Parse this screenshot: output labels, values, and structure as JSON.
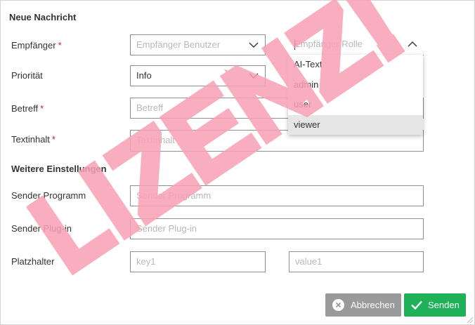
{
  "form": {
    "title": "Neue Nachricht",
    "section_title": "Weitere Einstellungen"
  },
  "labels": {
    "recipient": "Empfänger",
    "priority": "Priorität",
    "subject": "Betreff",
    "body": "Textinhalt",
    "sender_program": "Sender Programm",
    "sender_plugin": "Sender Plug-in",
    "placeholder": "Platzhalter",
    "required_mark": "*"
  },
  "fields": {
    "recipient_user_placeholder": "Empfänger Benutzer",
    "recipient_role_placeholder": "Empfänger Rolle",
    "priority_value": "Info",
    "subject_placeholder": "Betreff",
    "body_placeholder": "Textinhalt",
    "sender_program_placeholder": "Sender Programm",
    "sender_plugin_placeholder": "Sender Plug-in",
    "key_placeholder": "key1",
    "value_placeholder": "value1"
  },
  "role_dropdown": {
    "options": [
      "AI-Text",
      "admin",
      "user",
      "viewer"
    ],
    "highlighted": "viewer"
  },
  "buttons": {
    "cancel": "Abbrechen",
    "send": "Senden"
  },
  "watermark": {
    "text": "LIZENZ!",
    "color": "#f7a1b5"
  },
  "colors": {
    "send_button": "#1eb157",
    "cancel_button": "#9a9a9a",
    "focus_underline": "#2e9e96",
    "required": "#d02020"
  },
  "icons": {
    "select_chevron": "chevron-down-icon",
    "open_chevron": "chevron-up-icon",
    "cancel": "close-circle-icon",
    "send": "checkmark-icon"
  }
}
